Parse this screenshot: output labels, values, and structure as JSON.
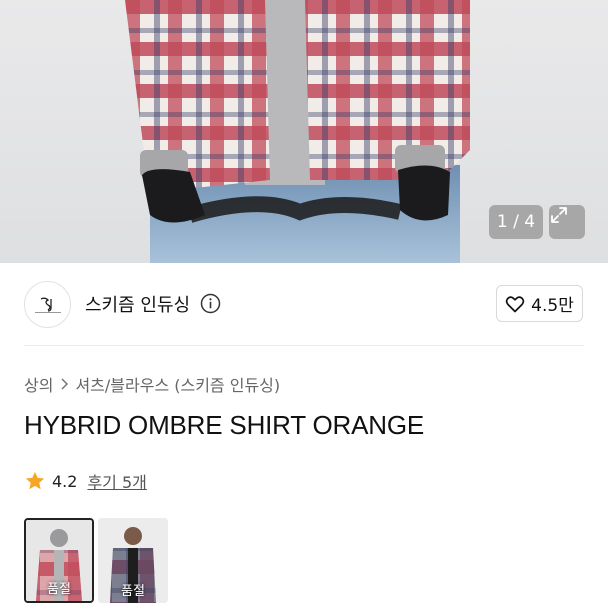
{
  "gallery": {
    "counter": "1 / 4",
    "expand_icon": "expand-icon"
  },
  "shop": {
    "name": "스키즘 인듀싱",
    "info_icon": "info-icon",
    "likes": "4.5만",
    "like_icon": "heart-icon"
  },
  "breadcrumb": {
    "root": "상의",
    "separator_icon": "chevron-right-icon",
    "category": "셔츠/블라우스 (스키즘 인듀싱)"
  },
  "product": {
    "title": "HYBRID OMBRE SHIRT ORANGE"
  },
  "rating": {
    "icon": "star-icon",
    "value": "4.2",
    "reviews": "후기 5개"
  },
  "thumbnails": [
    {
      "badge": "품절"
    },
    {
      "badge": "품절"
    }
  ],
  "colors": {
    "star": "#F5A623",
    "plaid_red": "#b83a4c",
    "denim": "#8fb0cf"
  }
}
